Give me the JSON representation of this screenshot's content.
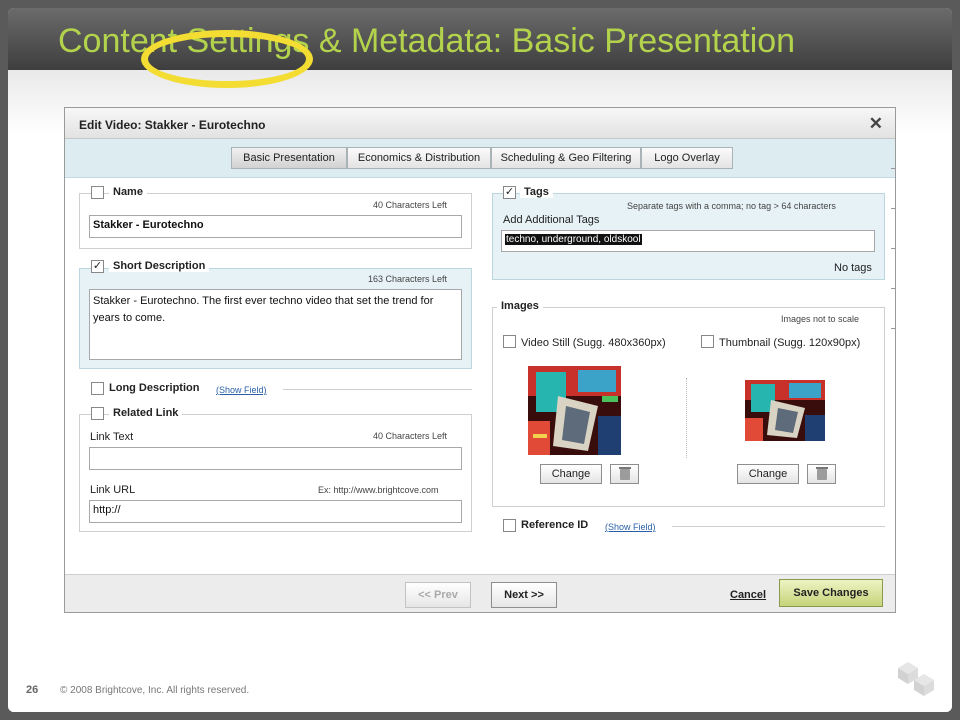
{
  "slide": {
    "title": "Content Settings & Metadata: Basic Presentation",
    "page_number": "26",
    "copyright": "© 2008 Brightcove, Inc. All rights reserved."
  },
  "dialog": {
    "title": "Edit Video: Stakker - Eurotechno",
    "close_glyph": "✕",
    "tabs": [
      {
        "label": "Basic Presentation",
        "active": true
      },
      {
        "label": "Economics & Distribution"
      },
      {
        "label": "Scheduling & Geo Filtering"
      },
      {
        "label": "Logo Overlay"
      }
    ],
    "name": {
      "label": "Name",
      "counter": "40 Characters Left",
      "value": "Stakker - Eurotechno"
    },
    "short_description": {
      "label": "Short Description",
      "check": "✓",
      "counter": "163 Characters Left",
      "value": "Stakker - Eurotechno. The first ever techno video that set the trend for years to come."
    },
    "long_description": {
      "label": "Long Description",
      "show_field": "(Show Field)"
    },
    "related_link": {
      "label": "Related Link",
      "link_text_label": "Link Text",
      "link_text_counter": "40 Characters Left",
      "link_text_value": "",
      "link_url_label": "Link URL",
      "link_url_hint": "Ex: http://www.brightcove.com",
      "link_url_value": "http://"
    },
    "tags": {
      "label": "Tags",
      "check": "✓",
      "hint": "Separate tags with a comma; no tag > 64 characters",
      "add_label": "Add Additional Tags",
      "value": "techno, underground, oldskool",
      "status": "No tags"
    },
    "images": {
      "label": "Images",
      "note": "Images not to scale",
      "video_still_label": "Video Still (Sugg. 480x360px)",
      "thumbnail_label": "Thumbnail (Sugg. 120x90px)",
      "change_label": "Change"
    },
    "reference_id": {
      "label": "Reference ID",
      "show_field": "(Show Field)"
    },
    "footer": {
      "prev_label": "<< Prev",
      "next_label": "Next >>",
      "cancel_label": "Cancel",
      "save_label": "Save Changes"
    }
  },
  "colors": {
    "title_green": "#b4d34c",
    "highlight_yellow": "#f3dd33",
    "tab_bar_blue": "#dcecf1",
    "save_green": "#c6d47a"
  }
}
